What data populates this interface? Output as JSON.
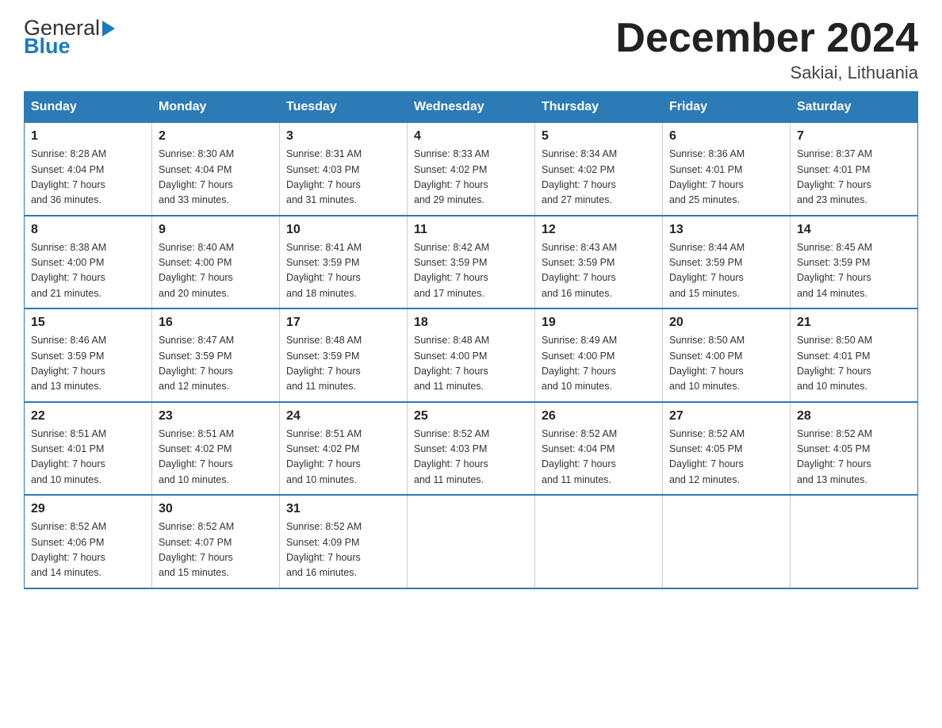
{
  "header": {
    "logo_general": "General",
    "logo_blue": "Blue",
    "month_title": "December 2024",
    "location": "Sakiai, Lithuania"
  },
  "weekdays": [
    "Sunday",
    "Monday",
    "Tuesday",
    "Wednesday",
    "Thursday",
    "Friday",
    "Saturday"
  ],
  "weeks": [
    [
      {
        "day": "1",
        "info": "Sunrise: 8:28 AM\nSunset: 4:04 PM\nDaylight: 7 hours\nand 36 minutes."
      },
      {
        "day": "2",
        "info": "Sunrise: 8:30 AM\nSunset: 4:04 PM\nDaylight: 7 hours\nand 33 minutes."
      },
      {
        "day": "3",
        "info": "Sunrise: 8:31 AM\nSunset: 4:03 PM\nDaylight: 7 hours\nand 31 minutes."
      },
      {
        "day": "4",
        "info": "Sunrise: 8:33 AM\nSunset: 4:02 PM\nDaylight: 7 hours\nand 29 minutes."
      },
      {
        "day": "5",
        "info": "Sunrise: 8:34 AM\nSunset: 4:02 PM\nDaylight: 7 hours\nand 27 minutes."
      },
      {
        "day": "6",
        "info": "Sunrise: 8:36 AM\nSunset: 4:01 PM\nDaylight: 7 hours\nand 25 minutes."
      },
      {
        "day": "7",
        "info": "Sunrise: 8:37 AM\nSunset: 4:01 PM\nDaylight: 7 hours\nand 23 minutes."
      }
    ],
    [
      {
        "day": "8",
        "info": "Sunrise: 8:38 AM\nSunset: 4:00 PM\nDaylight: 7 hours\nand 21 minutes."
      },
      {
        "day": "9",
        "info": "Sunrise: 8:40 AM\nSunset: 4:00 PM\nDaylight: 7 hours\nand 20 minutes."
      },
      {
        "day": "10",
        "info": "Sunrise: 8:41 AM\nSunset: 3:59 PM\nDaylight: 7 hours\nand 18 minutes."
      },
      {
        "day": "11",
        "info": "Sunrise: 8:42 AM\nSunset: 3:59 PM\nDaylight: 7 hours\nand 17 minutes."
      },
      {
        "day": "12",
        "info": "Sunrise: 8:43 AM\nSunset: 3:59 PM\nDaylight: 7 hours\nand 16 minutes."
      },
      {
        "day": "13",
        "info": "Sunrise: 8:44 AM\nSunset: 3:59 PM\nDaylight: 7 hours\nand 15 minutes."
      },
      {
        "day": "14",
        "info": "Sunrise: 8:45 AM\nSunset: 3:59 PM\nDaylight: 7 hours\nand 14 minutes."
      }
    ],
    [
      {
        "day": "15",
        "info": "Sunrise: 8:46 AM\nSunset: 3:59 PM\nDaylight: 7 hours\nand 13 minutes."
      },
      {
        "day": "16",
        "info": "Sunrise: 8:47 AM\nSunset: 3:59 PM\nDaylight: 7 hours\nand 12 minutes."
      },
      {
        "day": "17",
        "info": "Sunrise: 8:48 AM\nSunset: 3:59 PM\nDaylight: 7 hours\nand 11 minutes."
      },
      {
        "day": "18",
        "info": "Sunrise: 8:48 AM\nSunset: 4:00 PM\nDaylight: 7 hours\nand 11 minutes."
      },
      {
        "day": "19",
        "info": "Sunrise: 8:49 AM\nSunset: 4:00 PM\nDaylight: 7 hours\nand 10 minutes."
      },
      {
        "day": "20",
        "info": "Sunrise: 8:50 AM\nSunset: 4:00 PM\nDaylight: 7 hours\nand 10 minutes."
      },
      {
        "day": "21",
        "info": "Sunrise: 8:50 AM\nSunset: 4:01 PM\nDaylight: 7 hours\nand 10 minutes."
      }
    ],
    [
      {
        "day": "22",
        "info": "Sunrise: 8:51 AM\nSunset: 4:01 PM\nDaylight: 7 hours\nand 10 minutes."
      },
      {
        "day": "23",
        "info": "Sunrise: 8:51 AM\nSunset: 4:02 PM\nDaylight: 7 hours\nand 10 minutes."
      },
      {
        "day": "24",
        "info": "Sunrise: 8:51 AM\nSunset: 4:02 PM\nDaylight: 7 hours\nand 10 minutes."
      },
      {
        "day": "25",
        "info": "Sunrise: 8:52 AM\nSunset: 4:03 PM\nDaylight: 7 hours\nand 11 minutes."
      },
      {
        "day": "26",
        "info": "Sunrise: 8:52 AM\nSunset: 4:04 PM\nDaylight: 7 hours\nand 11 minutes."
      },
      {
        "day": "27",
        "info": "Sunrise: 8:52 AM\nSunset: 4:05 PM\nDaylight: 7 hours\nand 12 minutes."
      },
      {
        "day": "28",
        "info": "Sunrise: 8:52 AM\nSunset: 4:05 PM\nDaylight: 7 hours\nand 13 minutes."
      }
    ],
    [
      {
        "day": "29",
        "info": "Sunrise: 8:52 AM\nSunset: 4:06 PM\nDaylight: 7 hours\nand 14 minutes."
      },
      {
        "day": "30",
        "info": "Sunrise: 8:52 AM\nSunset: 4:07 PM\nDaylight: 7 hours\nand 15 minutes."
      },
      {
        "day": "31",
        "info": "Sunrise: 8:52 AM\nSunset: 4:09 PM\nDaylight: 7 hours\nand 16 minutes."
      },
      {
        "day": "",
        "info": ""
      },
      {
        "day": "",
        "info": ""
      },
      {
        "day": "",
        "info": ""
      },
      {
        "day": "",
        "info": ""
      }
    ]
  ]
}
